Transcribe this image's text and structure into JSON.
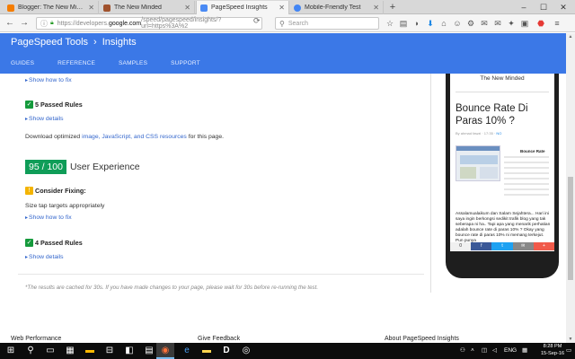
{
  "browser": {
    "tabs": [
      {
        "title": "Blogger: The New Minded...",
        "favicon_color": "#f57d00",
        "active": false
      },
      {
        "title": "The New Minded",
        "favicon_color": "#a0522d",
        "active": false
      },
      {
        "title": "PageSpeed Insights",
        "favicon_color": "#4a8af4",
        "active": true
      },
      {
        "title": "Mobile-Friendly Test",
        "favicon_color": "#4285f4",
        "active": false
      }
    ],
    "url": {
      "prefix": "https://developers.",
      "domain": "google.com",
      "suffix": "/speed/pagespeed/insights/?url=https%3A%2"
    },
    "search_placeholder": "Search"
  },
  "header": {
    "brand": "PageSpeed Tools",
    "chevron": "›",
    "section": "Insights",
    "nav": [
      "GUIDES",
      "REFERENCE",
      "SAMPLES",
      "SUPPORT"
    ]
  },
  "results": {
    "show_how_to_fix_1": "Show how to fix",
    "passed_rules_1": "5 Passed Rules",
    "show_details_1": "Show details",
    "download_prefix": "Download optimized ",
    "download_link": "image, JavaScript, and CSS resources",
    "download_suffix": " for this page.",
    "ux_score": "95 / 100",
    "ux_title": "User Experience",
    "consider_fixing": "Consider Fixing:",
    "rule_tap_targets": "Size tap targets appropriately",
    "show_how_to_fix_2": "Show how to fix",
    "passed_rules_2": "4 Passed Rules",
    "show_details_2": "Show details",
    "cache_note": "*The results are cached for 30s. If you have made changes to your page, please wait for 30s before re-running the test."
  },
  "phone_preview": {
    "site_name": "The New Minded",
    "post_title": "Bounce Rate Di Paras 10% ?",
    "post_meta_author": "By ahmad fawzi",
    "post_meta_time": "17:35",
    "post_meta_comments": "NO",
    "side_label": "Bounce Rate",
    "excerpt": "Assalamualaikum dan Salam Sejahtera... Hari ini saya ingin berkongsi sedikit trafik blog yang tak seberapa ni ha.. Tapi apa yang menarik perhatian adalah bounce rate di paras 10% ? Okay yang bounce rate di paras 10% ni memang terkejut. Pun punya",
    "share_buttons": [
      {
        "label": "0",
        "color": "#f0f0f0",
        "text_color": "#333"
      },
      {
        "label": "f",
        "color": "#3b5998"
      },
      {
        "label": "t",
        "color": "#1da1f2"
      },
      {
        "label": "✉",
        "color": "#888888"
      },
      {
        "label": "+",
        "color": "#f15a4a"
      }
    ]
  },
  "footer": {
    "col1": "Web Performance",
    "col2": "Give Feedback",
    "col3": "About PageSpeed Insights"
  },
  "taskbar": {
    "time": "8:28 PM",
    "date": "15-Sep-16",
    "language": "ENG"
  }
}
